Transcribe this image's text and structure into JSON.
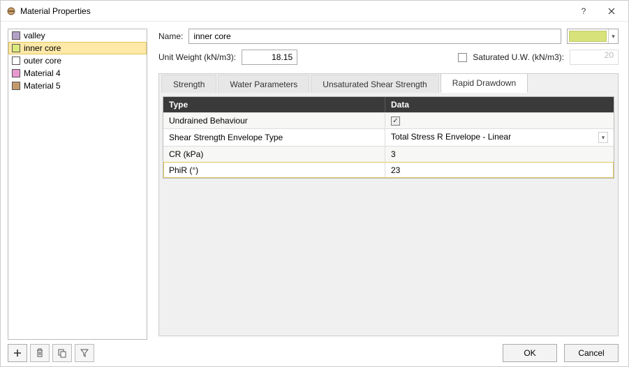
{
  "window": {
    "title": "Material Properties"
  },
  "materials": {
    "items": [
      {
        "label": "valley",
        "color": "#b3a1c5"
      },
      {
        "label": "inner core",
        "color": "#dce97b"
      },
      {
        "label": "outer core",
        "color": "#ffffff"
      },
      {
        "label": "Material 4",
        "color": "#e89ad0"
      },
      {
        "label": "Material 5",
        "color": "#c49a6c"
      }
    ],
    "selected_index": 1
  },
  "form": {
    "name_label": "Name:",
    "name_value": "inner core",
    "unit_weight_label": "Unit Weight (kN/m3):",
    "unit_weight_value": "18.15",
    "sat_uw_label": "Saturated U.W. (kN/m3):",
    "sat_uw_value": "20",
    "color_value": "#d7e37a"
  },
  "tabs": {
    "items": [
      {
        "label": "Strength"
      },
      {
        "label": "Water Parameters"
      },
      {
        "label": "Unsaturated Shear Strength"
      },
      {
        "label": "Rapid Drawdown"
      }
    ],
    "active_index": 3
  },
  "grid": {
    "headers": {
      "type": "Type",
      "data": "Data"
    },
    "rows": [
      {
        "type": "Undrained Behaviour",
        "kind": "check",
        "checked": true
      },
      {
        "type": "Shear Strength Envelope Type",
        "kind": "select",
        "value": "Total Stress R Envelope - Linear"
      },
      {
        "type": "CR (kPa)",
        "kind": "text",
        "value": "3"
      },
      {
        "type": "PhiR (°)",
        "kind": "text",
        "value": "23"
      }
    ]
  },
  "footer": {
    "ok": "OK",
    "cancel": "Cancel"
  }
}
